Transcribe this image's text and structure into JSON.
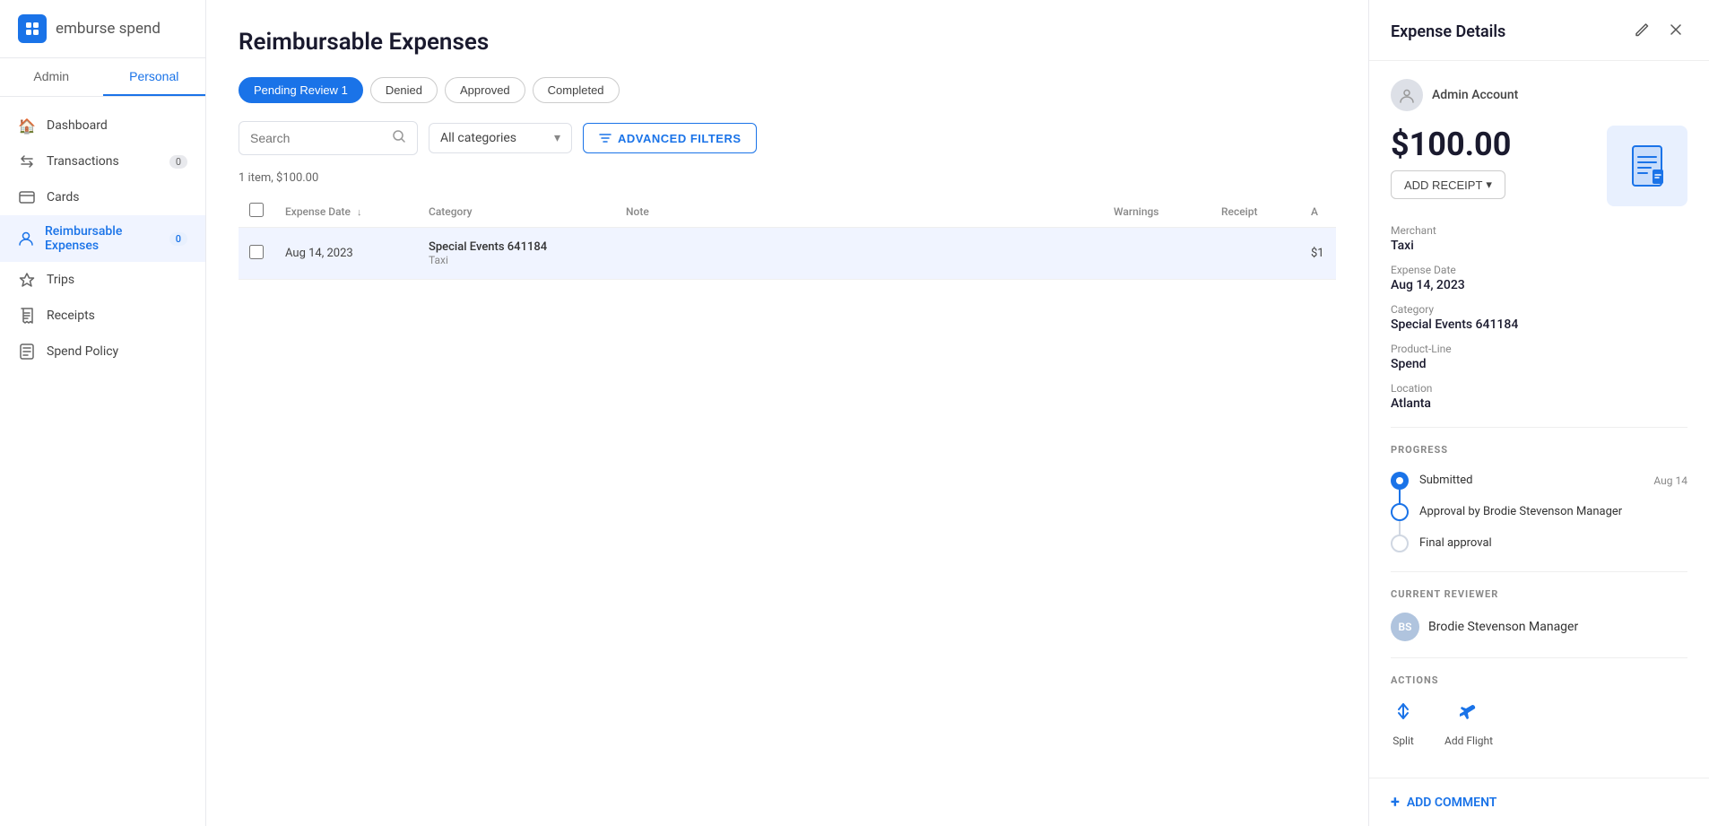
{
  "app": {
    "logo_text": "emburse",
    "logo_text2": "spend"
  },
  "sidebar": {
    "tabs": [
      {
        "label": "Admin",
        "active": false
      },
      {
        "label": "Personal",
        "active": true
      }
    ],
    "nav_items": [
      {
        "id": "dashboard",
        "label": "Dashboard",
        "icon": "🏠",
        "badge": null,
        "active": false
      },
      {
        "id": "transactions",
        "label": "Transactions",
        "icon": "↔",
        "badge": "0",
        "active": false
      },
      {
        "id": "cards",
        "label": "Cards",
        "icon": "💳",
        "badge": null,
        "active": false
      },
      {
        "id": "reimbursable",
        "label": "Reimbursable Expenses",
        "icon": "👤",
        "badge": "0",
        "active": true
      },
      {
        "id": "trips",
        "label": "Trips",
        "icon": "✈",
        "badge": null,
        "active": false
      },
      {
        "id": "receipts",
        "label": "Receipts",
        "icon": "📄",
        "badge": null,
        "active": false
      },
      {
        "id": "spend-policy",
        "label": "Spend Policy",
        "icon": "📋",
        "badge": null,
        "active": false
      }
    ]
  },
  "main": {
    "page_title": "Reimbursable Expenses",
    "filter_tabs": [
      {
        "label": "Pending Review",
        "badge": "1",
        "active": true
      },
      {
        "label": "Denied",
        "active": false
      },
      {
        "label": "Approved",
        "active": false
      },
      {
        "label": "Completed",
        "active": false
      }
    ],
    "search_placeholder": "Search",
    "category_placeholder": "All categories",
    "adv_filter_label": "ADVANCED FILTERS",
    "results_text": "1 item, $100.00",
    "table": {
      "columns": [
        "",
        "Expense Date",
        "Category",
        "Note",
        "Warnings",
        "Receipt",
        "A"
      ],
      "rows": [
        {
          "date": "Aug 14, 2023",
          "category_main": "Special Events 641184",
          "category_sub": "Taxi",
          "note": "",
          "warnings": "",
          "receipt": "",
          "amount": "$1"
        }
      ]
    }
  },
  "expense_details": {
    "panel_title": "Expense Details",
    "admin_name": "Admin Account",
    "amount": "$100.00",
    "merchant_label": "Merchant",
    "merchant_value": "Taxi",
    "expense_date_label": "Expense Date",
    "expense_date_value": "Aug 14, 2023",
    "category_label": "Category",
    "category_value": "Special Events 641184",
    "product_line_label": "Product-Line",
    "product_line_value": "Spend",
    "location_label": "Location",
    "location_value": "Atlanta",
    "add_receipt_label": "ADD RECEIPT",
    "progress_label": "PROGRESS",
    "progress_steps": [
      {
        "label": "Submitted",
        "date": "Aug 14",
        "type": "filled"
      },
      {
        "label": "Approval by Brodie Stevenson Manager",
        "date": "",
        "type": "half"
      },
      {
        "label": "Final approval",
        "date": "",
        "type": "empty"
      }
    ],
    "current_reviewer_label": "Current Reviewer",
    "reviewer_initials": "BS",
    "reviewer_name": "Brodie Stevenson Manager",
    "actions_label": "ACTIONS",
    "actions": [
      {
        "label": "Split",
        "icon": "split"
      },
      {
        "label": "Add Flight",
        "icon": "flight"
      }
    ],
    "add_comment_label": "ADD COMMENT"
  }
}
